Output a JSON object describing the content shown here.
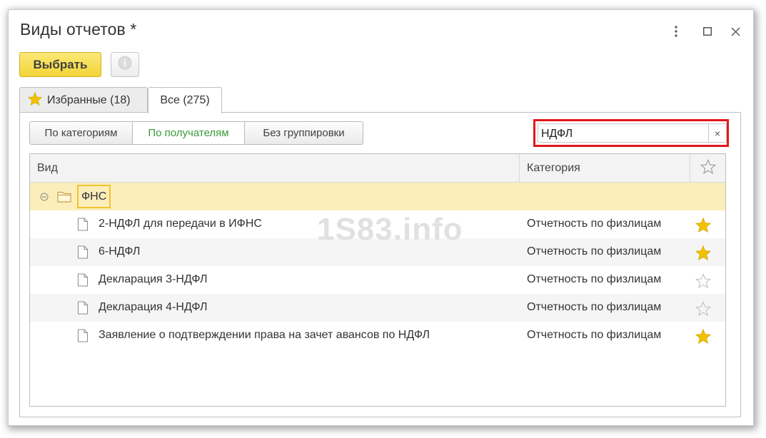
{
  "window": {
    "title": "Виды отчетов *"
  },
  "toolbar": {
    "select_label": "Выбрать"
  },
  "tabs": [
    {
      "label": "Избранные (18)"
    },
    {
      "label": "Все (275)"
    }
  ],
  "grouping": [
    {
      "label": "По категориям"
    },
    {
      "label": "По получателям",
      "selected": true
    },
    {
      "label": "Без группировки"
    }
  ],
  "search": {
    "value": "НДФЛ",
    "clear_label": "×"
  },
  "table": {
    "columns": [
      "Вид",
      "Категория"
    ],
    "group": {
      "label": "ФНС"
    },
    "rows": [
      {
        "name": "2-НДФЛ для передачи в ИФНС",
        "category": "Отчетность по физлицам",
        "favorite": true
      },
      {
        "name": "6-НДФЛ",
        "category": "Отчетность по физлицам",
        "favorite": true
      },
      {
        "name": "Декларация 3-НДФЛ",
        "category": "Отчетность по физлицам",
        "favorite": false
      },
      {
        "name": "Декларация 4-НДФЛ",
        "category": "Отчетность по физлицам",
        "favorite": false
      },
      {
        "name": "Заявление о подтверждении права на зачет авансов по НДФЛ",
        "category": "Отчетность по физлицам",
        "favorite": true
      }
    ]
  },
  "watermark": "1S83.info",
  "colors": {
    "accent_yellow": "#f3d436",
    "group_highlight": "#fbeebb",
    "selected_text_green": "#3a9a3a",
    "search_frame_red": "#e4161c",
    "star_gold": "#f2c200"
  }
}
